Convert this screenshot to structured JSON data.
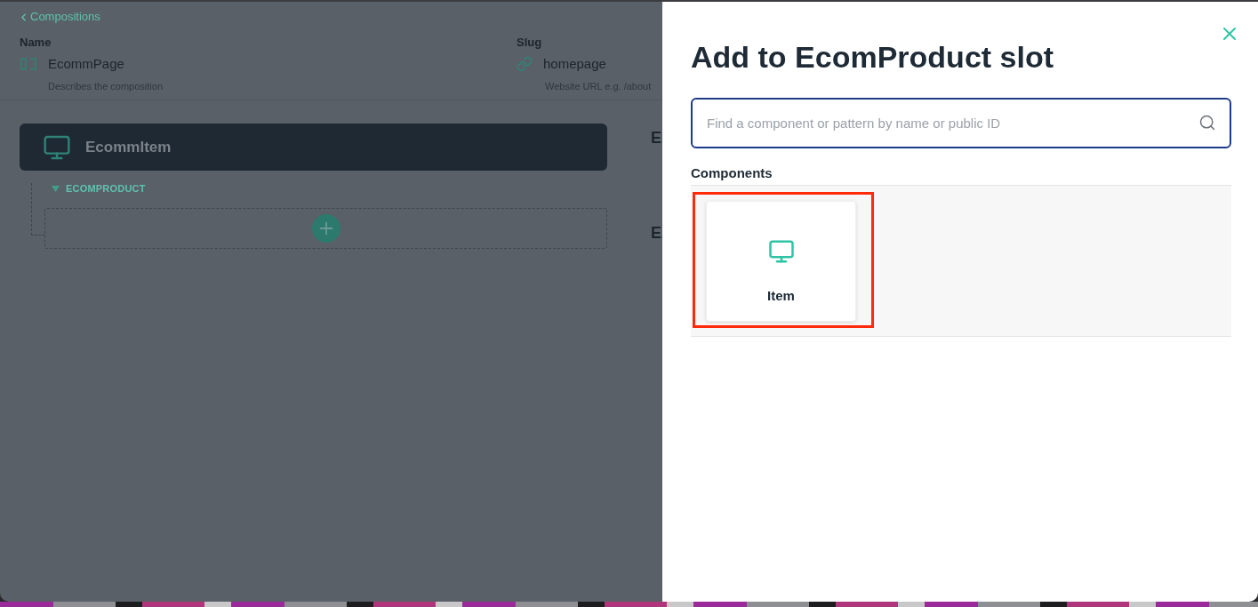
{
  "background_page": {
    "back_link": {
      "label": "Compositions"
    },
    "fields": [
      {
        "kind": "name",
        "label": "Name",
        "value": "EcommPage",
        "hint": "Describes the composition"
      },
      {
        "kind": "slug",
        "label": "Slug",
        "value": "homepage",
        "hint": "Website URL e.g. /about"
      }
    ],
    "component": {
      "name": "EcommItem",
      "slots": [
        {
          "name": "ECOMPRODUCT",
          "expanded": true
        }
      ]
    },
    "side_panel": {
      "headings": [
        "E",
        "E"
      ]
    }
  },
  "dialog": {
    "title": "Add to EcomProduct slot",
    "search": {
      "placeholder": "Find a component or pattern by name or public ID"
    },
    "section_title": "Components",
    "components": [
      {
        "name": "Item",
        "highlighted": true
      }
    ]
  }
}
